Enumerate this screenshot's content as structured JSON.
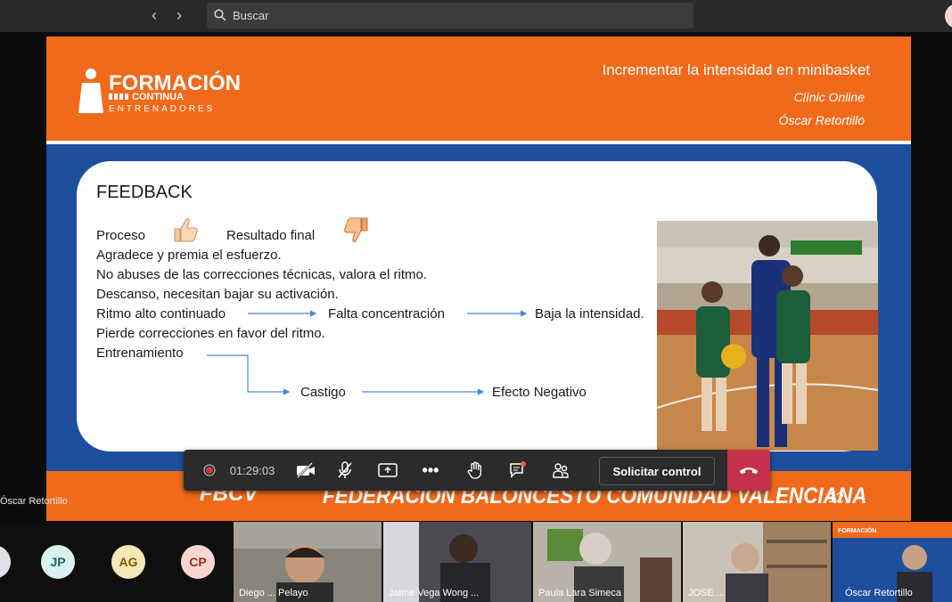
{
  "topbar": {
    "search_placeholder": "Buscar",
    "back_icon": "chevron-left-icon",
    "forward_icon": "chevron-right-icon"
  },
  "slide": {
    "logo": {
      "line1": "FORMACIÓN",
      "line2": "CONTINUA",
      "line3": "ENTRENADORES"
    },
    "header_title": "Incrementar la intensidad en minibasket",
    "header_sub1": "Clínic Online",
    "header_sub2": "Óscar Retortillo",
    "title": "FEEDBACK",
    "lines": {
      "proceso": "Proceso",
      "resultado": "Resultado final",
      "l1": "Agradece y premia el esfuerzo.",
      "l2": "No abuses de las correcciones técnicas, valora el ritmo.",
      "l3": "Descanso, necesitan bajar su activación.",
      "ritmo": "Ritmo alto continuado",
      "falta": "Falta concentración",
      "baja": "Baja la intensidad.",
      "l5": "Pierde correcciones en favor del ritmo.",
      "entreno": "Entrenamiento",
      "castigo": "Castigo",
      "efecto": "Efecto Negativo"
    },
    "footer_logo": "FBCV",
    "footer_text": "FEDERACIÓN BALONCESTO COMUNIDAD VALENCIANA",
    "page_number": "12"
  },
  "controls": {
    "timer": "01:29:03",
    "request_control": "Solicitar control"
  },
  "presenter_label": "Óscar Retortillo",
  "participants": [
    {
      "initials": "JP",
      "bg": "#d9f1f1",
      "fg": "#0f6b6b"
    },
    {
      "initials": "AG",
      "bg": "#f5e7b8",
      "fg": "#7a5a00"
    },
    {
      "initials": "CP",
      "bg": "#f6d7cf",
      "fg": "#9b2d1a"
    }
  ],
  "video_tiles": [
    {
      "name": "Diego ... Pelayo"
    },
    {
      "name": "Jaime Vega Wong ..."
    },
    {
      "name": "Paula Lara Simeca"
    },
    {
      "name": "JOSE ..."
    },
    {
      "name": "Óscar Retortillo"
    }
  ],
  "colors": {
    "orange": "#f06a1c",
    "blue": "#1e4f9c",
    "hangup": "#c4314b"
  }
}
